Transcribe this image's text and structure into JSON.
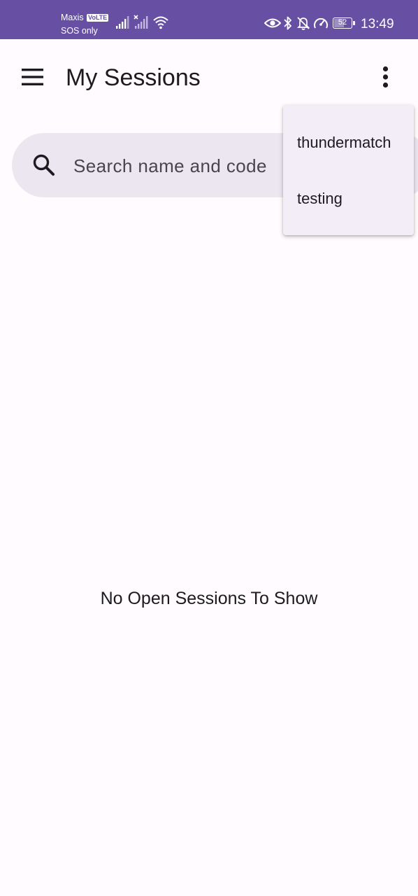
{
  "status_bar": {
    "carrier": "Maxis",
    "volte_badge": "VoLTE",
    "network_status": "SOS only",
    "battery_level": "52",
    "time": "13:49",
    "icons": [
      "signal-icon",
      "signal-no-service-icon",
      "wifi-icon",
      "eye-icon",
      "bluetooth-icon",
      "bell-off-icon",
      "speedometer-icon",
      "battery-icon"
    ]
  },
  "app_bar": {
    "title": "My Sessions",
    "menu_icon": "hamburger-menu-icon",
    "overflow_icon": "more-vertical-icon"
  },
  "search": {
    "placeholder": "Search name and code",
    "value": "",
    "icon": "search-icon"
  },
  "empty_state": {
    "message": "No Open Sessions To Show"
  },
  "dropdown_menu": {
    "items": [
      {
        "label": "thundermatch"
      },
      {
        "label": "testing"
      }
    ]
  },
  "colors": {
    "status_bar_bg": "#6750a4",
    "background": "#fffbfe",
    "search_bg": "#ece6f0",
    "menu_bg": "#f3edf7",
    "text": "#1c1b1f"
  }
}
